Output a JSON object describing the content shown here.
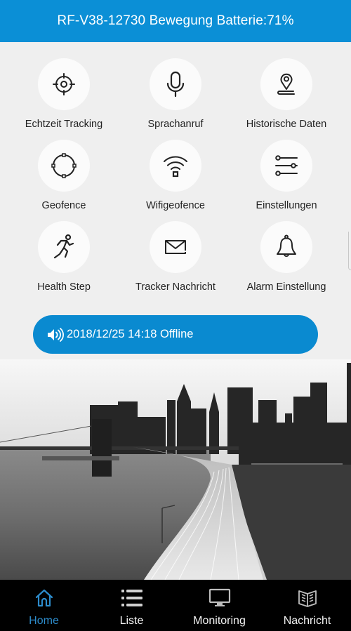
{
  "header": {
    "title": "RF-V38-12730 Bewegung Batterie:71%"
  },
  "menu": {
    "items": [
      {
        "label": "Echtzeit Tracking",
        "icon": "crosshair-icon"
      },
      {
        "label": "Sprachanruf",
        "icon": "microphone-icon"
      },
      {
        "label": "Historische Daten",
        "icon": "map-pin-path-icon"
      },
      {
        "label": "Geofence",
        "icon": "geofence-circle-icon"
      },
      {
        "label": "Wifigeofence",
        "icon": "wifi-icon"
      },
      {
        "label": "Einstellungen",
        "icon": "sliders-icon"
      },
      {
        "label": "Health Step",
        "icon": "running-person-icon"
      },
      {
        "label": "Tracker Nachricht",
        "icon": "envelope-icon"
      },
      {
        "label": "Alarm Einstellung",
        "icon": "bell-icon"
      }
    ]
  },
  "status": {
    "icon": "speaker-icon",
    "text": "2018/12/25 14:18 Offline"
  },
  "banner": {
    "description": "black-and-white city skyline with bridge and highway"
  },
  "tabbar": {
    "active": "Home",
    "active_color": "#2d8ccc",
    "items": [
      {
        "label": "Home",
        "icon": "home-icon"
      },
      {
        "label": "Liste",
        "icon": "list-icon"
      },
      {
        "label": "Monitoring",
        "icon": "monitor-icon"
      },
      {
        "label": "Nachricht",
        "icon": "book-icon"
      }
    ]
  },
  "colors": {
    "primary": "#0b8fd6",
    "background": "#efefef",
    "tabbar_bg": "#000000"
  }
}
